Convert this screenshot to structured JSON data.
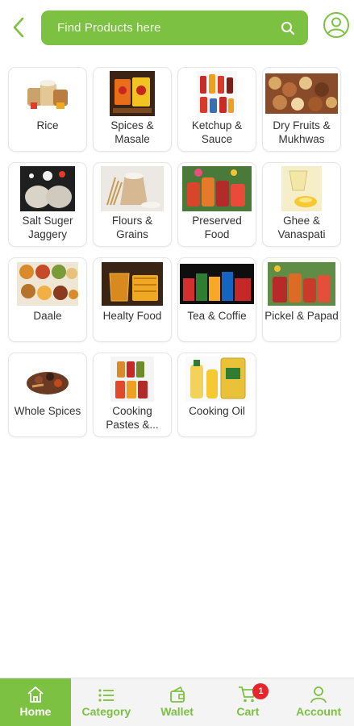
{
  "header": {
    "search_placeholder": "Find Products here",
    "back_icon": "chevron-left-icon",
    "search_icon": "search-icon",
    "profile_icon": "user-circle-icon",
    "accent_color": "#7cc142"
  },
  "categories": [
    {
      "label": "Rice",
      "icon": "rice-sacks"
    },
    {
      "label": "Spices & Masale",
      "icon": "spice-packs"
    },
    {
      "label": "Ketchup & Sauce",
      "icon": "sauce-bottles"
    },
    {
      "label": "Dry Fruits & Mukhwas",
      "icon": "dry-fruits"
    },
    {
      "label": "Salt Suger Jaggery",
      "icon": "salt-sugar-jars"
    },
    {
      "label": "Flours & Grains",
      "icon": "flour-sack"
    },
    {
      "label": "Preserved Food",
      "icon": "jars"
    },
    {
      "label": "Ghee & Vanaspati",
      "icon": "ghee-pour"
    },
    {
      "label": "Daale",
      "icon": "lentil-bowls"
    },
    {
      "label": "Healty Food",
      "icon": "honey"
    },
    {
      "label": "Tea & Coffie",
      "icon": "tea-packs"
    },
    {
      "label": "Pickel & Papad",
      "icon": "pickle-jars"
    },
    {
      "label": "Whole Spices",
      "icon": "whole-spices"
    },
    {
      "label": "Cooking Pastes &...",
      "icon": "paste-jars"
    },
    {
      "label": "Cooking Oil",
      "icon": "oil-bottles"
    }
  ],
  "bottom_nav": {
    "items": [
      {
        "label": "Home",
        "icon": "home-icon",
        "active": true
      },
      {
        "label": "Category",
        "icon": "list-icon",
        "active": false
      },
      {
        "label": "Wallet",
        "icon": "wallet-icon",
        "active": false
      },
      {
        "label": "Cart",
        "icon": "cart-icon",
        "active": false,
        "badge": "1"
      },
      {
        "label": "Account",
        "icon": "user-icon",
        "active": false
      }
    ]
  }
}
